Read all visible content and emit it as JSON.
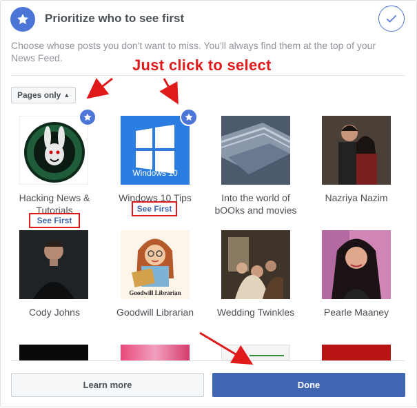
{
  "header": {
    "title": "Prioritize who to see first",
    "icon": "star-icon",
    "confirm_icon": "checkmark-icon"
  },
  "description": "Choose whose posts you don't want to miss. You'll always find them at the top of your News Feed.",
  "annotation": "Just click to select",
  "filter": {
    "label": "Pages only",
    "icon": "sort-arrows-icon"
  },
  "see_first_label": "See First",
  "pages": [
    {
      "name": "Hacking News & Tutorials",
      "starred": true,
      "see_first": true,
      "image": "white-rabbit-logo"
    },
    {
      "name": "Windows 10 Tips",
      "starred": true,
      "see_first": true,
      "image": "windows-10-logo",
      "logo_text": "Windows 10"
    },
    {
      "name": "Into the world of bOOks and movies",
      "starred": false,
      "see_first": false,
      "image": "books-photo"
    },
    {
      "name": "Nazriya Nazim",
      "starred": false,
      "see_first": false,
      "image": "couple-photo"
    },
    {
      "name": "Cody Johns",
      "starred": false,
      "see_first": false,
      "image": "man-portrait"
    },
    {
      "name": "Goodwill Librarian",
      "starred": false,
      "see_first": false,
      "image": "librarian-cartoon",
      "logo_text": "Goodwill Librarian"
    },
    {
      "name": "Wedding Twinkles",
      "starred": false,
      "see_first": false,
      "image": "wedding-photo"
    },
    {
      "name": "Pearle Maaney",
      "starred": false,
      "see_first": false,
      "image": "woman-portrait"
    }
  ],
  "buttons": {
    "learn_more": "Learn more",
    "done": "Done"
  },
  "colors": {
    "accent": "#4267b2",
    "star": "#4c75d8",
    "annotation": "#e01a1a"
  }
}
